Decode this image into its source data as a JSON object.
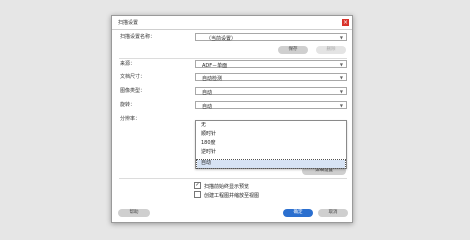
{
  "dialog": {
    "title": "扫描设置",
    "close_glyph": "×"
  },
  "preset": {
    "label": "扫描设置名称：",
    "value": "（当前设置）",
    "save_label": "保存",
    "delete_label": "删除"
  },
  "fields": [
    {
      "label": "来源：",
      "value": "ADF－单面"
    },
    {
      "label": "文档尺寸：",
      "value": "自动检测"
    },
    {
      "label": "图像类型：",
      "value": "自动"
    },
    {
      "label": "旋转：",
      "value": "自动"
    }
  ],
  "resolution_label": "分辨率：",
  "rotation_options": [
    "无",
    "顺时针",
    "180度",
    "逆时针",
    "自动"
  ],
  "rotation_selected": "自动",
  "detail_button": "详细设置",
  "checkboxes": [
    {
      "label": "扫描前始终显示预览",
      "checked": true
    },
    {
      "label": "创建工程图并缩放至视图",
      "checked": false
    }
  ],
  "footer": {
    "help_label": "帮助",
    "ok_label": "确定",
    "cancel_label": "取消"
  }
}
